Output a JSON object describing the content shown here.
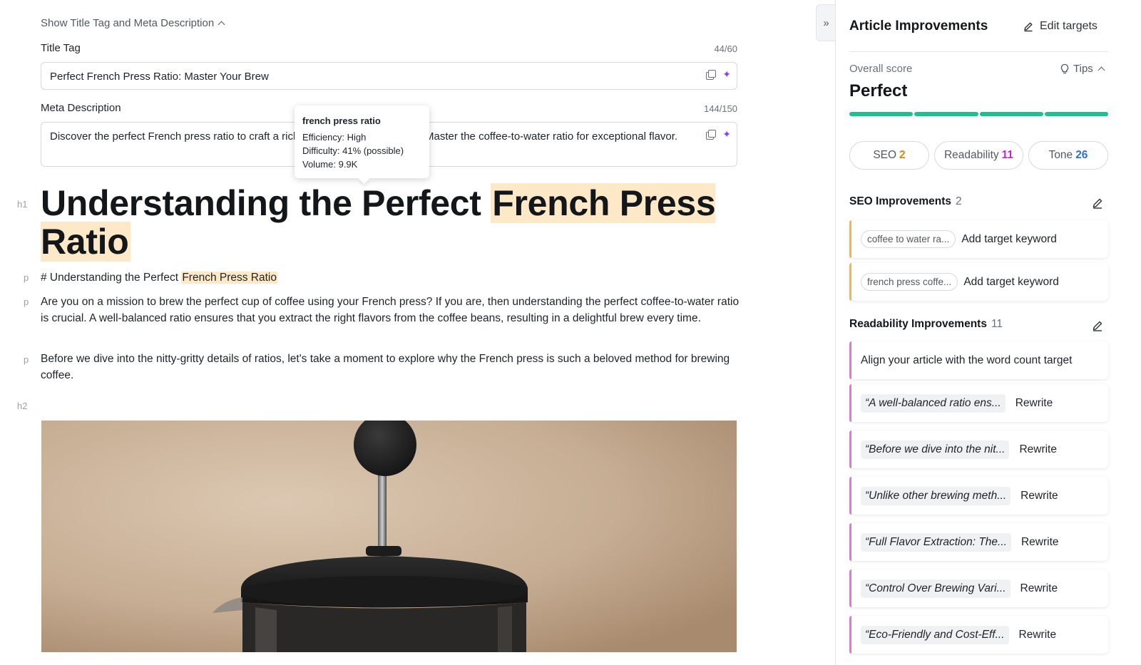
{
  "editor": {
    "meta_toggle": "Show Title Tag and Meta Description",
    "title_tag": {
      "label": "Title Tag",
      "count": "44/60",
      "value": "Perfect French Press Ratio: Master Your Brew"
    },
    "meta_description": {
      "label": "Meta Description",
      "count": "144/150",
      "value": "Discover the perfect French press ratio to craft a rich, delicious cup every time. Master the coffee-to-water ratio for exceptional flavor."
    },
    "tooltip": {
      "title": "french press ratio",
      "efficiency": "Efficiency: High",
      "difficulty": "Difficulty: 41% (possible)",
      "volume": "Volume: 9.9K"
    },
    "gutter": {
      "h1": "h1",
      "p": "p",
      "h2": "h2"
    },
    "h1": {
      "text_before": "Understanding the Perfect ",
      "highlight": "French Press Ratio"
    },
    "paragraphs": [
      {
        "prefix": "# Understanding the Perfect ",
        "highlight": "French Press Ratio"
      },
      {
        "text": "Are you on a mission to brew the perfect cup of coffee using your French press? If you are, then understanding the perfect coffee-to-water ratio is crucial. A well-balanced ratio ensures that you extract the right flavors from the coffee beans, resulting in a delightful brew every time."
      },
      {
        "text": "Before we dive into the nitty-gritty details of ratios, let's take a moment to explore why the French press is such a beloved method for brewing coffee."
      }
    ]
  },
  "panel": {
    "title": "Article Improvements",
    "edit_targets": "Edit targets",
    "overall_score_label": "Overall score",
    "tips": "Tips",
    "score_value": "Perfect",
    "score_color": "#1fbf8f",
    "tabs": [
      {
        "label": "SEO",
        "count": "2",
        "color": "#d9861a"
      },
      {
        "label": "Readability",
        "count": "11",
        "color": "#c026d3"
      },
      {
        "label": "Tone",
        "count": "26",
        "color": "#2f6fd6"
      }
    ],
    "seo_section": {
      "title": "SEO Improvements",
      "count": "2",
      "items": [
        {
          "keyword": "coffee to water ra...",
          "action": "Add target keyword"
        },
        {
          "keyword": "french press coffe...",
          "action": "Add target keyword"
        }
      ]
    },
    "readability_section": {
      "title": "Readability Improvements",
      "count": "11",
      "word_count_item": "Align your article with the word count target",
      "items": [
        {
          "quote": "“A well-balanced ratio ens...",
          "action": "Rewrite"
        },
        {
          "quote": "“Before we dive into the nit...",
          "action": "Rewrite"
        },
        {
          "quote": "“Unlike other brewing meth...",
          "action": "Rewrite"
        },
        {
          "quote": "“Full Flavor Extraction: The...",
          "action": "Rewrite"
        },
        {
          "quote": "“Control Over Brewing Vari...",
          "action": "Rewrite"
        },
        {
          "quote": "“Eco-Friendly and Cost-Eff...",
          "action": "Rewrite"
        }
      ]
    }
  }
}
